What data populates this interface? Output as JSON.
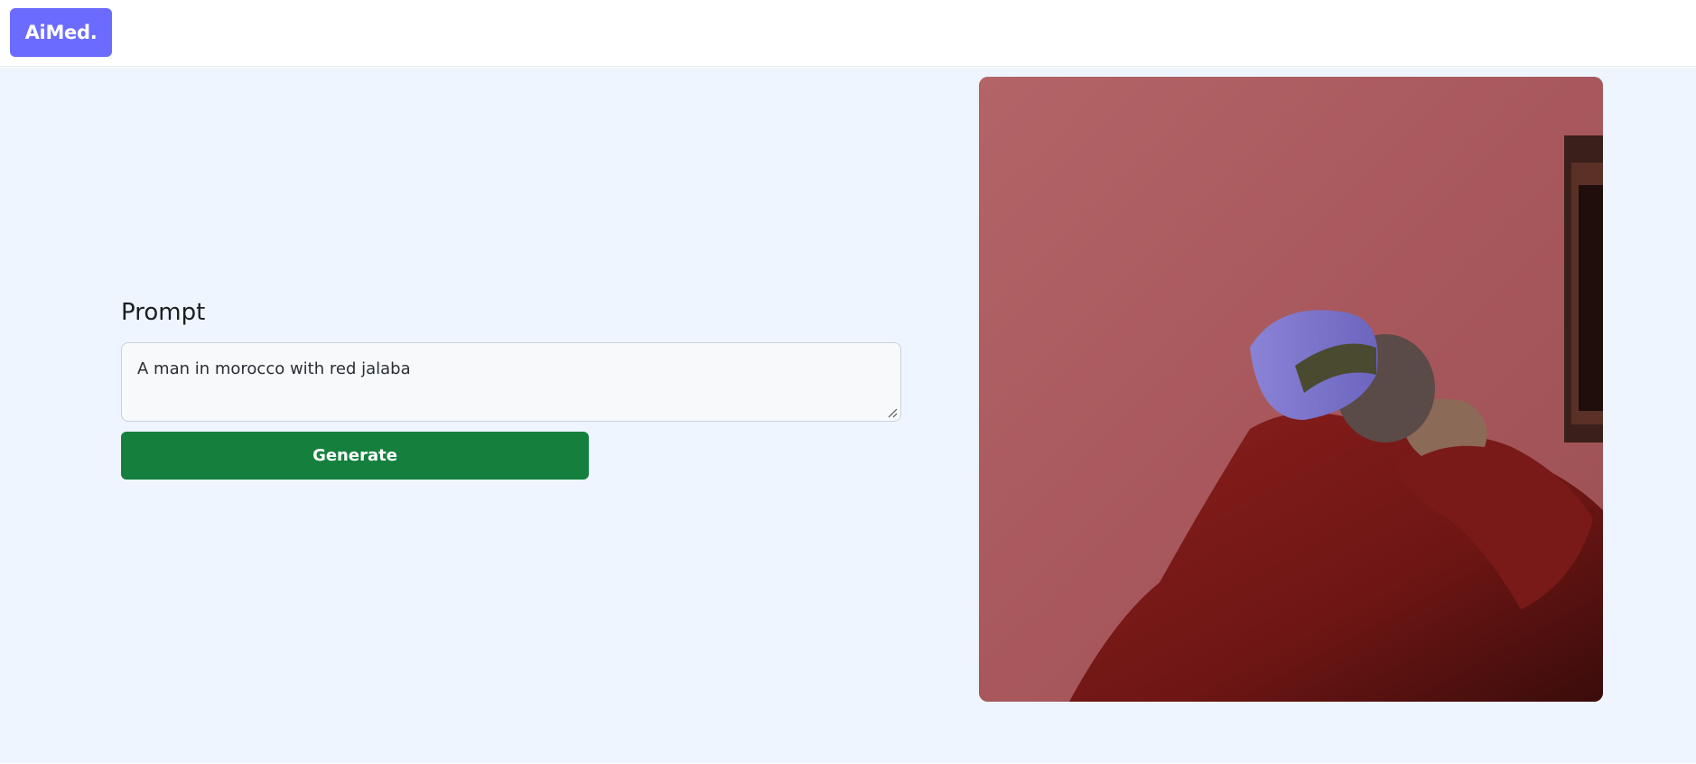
{
  "header": {
    "brand_label": "AiMed."
  },
  "form": {
    "label": "Prompt",
    "prompt_value": "A man in morocco with red jalaba",
    "generate_label": "Generate"
  },
  "generated_image": {
    "alt": "A man in morocco with red jalaba"
  },
  "colors": {
    "brand": "#6b6bff",
    "background": "#eef5fe",
    "button": "#15803d"
  }
}
